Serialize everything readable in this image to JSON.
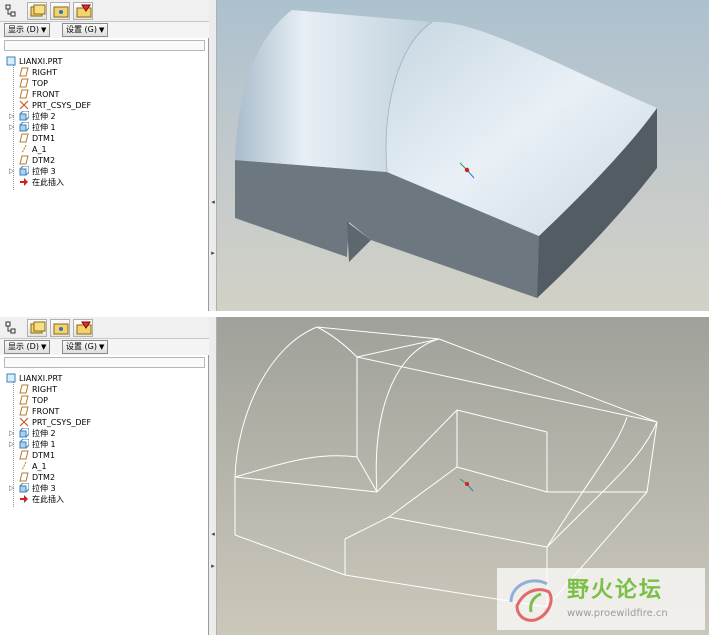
{
  "panels": [
    {
      "toolbar": {
        "menu_display": "显示",
        "menu_display_key": "(D)",
        "menu_settings": "设置",
        "menu_settings_key": "(G)"
      },
      "tree": [
        {
          "label": "LIANXI.PRT",
          "icon": "part-icon"
        },
        {
          "label": "RIGHT",
          "icon": "datum-plane-icon"
        },
        {
          "label": "TOP",
          "icon": "datum-plane-icon"
        },
        {
          "label": "FRONT",
          "icon": "datum-plane-icon"
        },
        {
          "label": "PRT_CSYS_DEF",
          "icon": "csys-icon"
        },
        {
          "label": "拉伸 2",
          "icon": "extrude-icon"
        },
        {
          "label": "拉伸 1",
          "icon": "extrude-icon"
        },
        {
          "label": "DTM1",
          "icon": "datum-plane-icon"
        },
        {
          "label": "A_1",
          "icon": "datum-axis-icon"
        },
        {
          "label": "DTM2",
          "icon": "datum-plane-icon"
        },
        {
          "label": "拉伸 3",
          "icon": "extrude-icon"
        },
        {
          "label": "在此插入",
          "icon": "insert-here-icon"
        }
      ],
      "view_mode": "shaded"
    },
    {
      "toolbar": {
        "menu_display": "显示",
        "menu_display_key": "(D)",
        "menu_settings": "设置",
        "menu_settings_key": "(G)"
      },
      "tree": [
        {
          "label": "LIANXI.PRT",
          "icon": "part-icon"
        },
        {
          "label": "RIGHT",
          "icon": "datum-plane-icon"
        },
        {
          "label": "TOP",
          "icon": "datum-plane-icon"
        },
        {
          "label": "FRONT",
          "icon": "datum-plane-icon"
        },
        {
          "label": "PRT_CSYS_DEF",
          "icon": "csys-icon"
        },
        {
          "label": "拉伸 2",
          "icon": "extrude-icon"
        },
        {
          "label": "拉伸 1",
          "icon": "extrude-icon"
        },
        {
          "label": "DTM1",
          "icon": "datum-plane-icon"
        },
        {
          "label": "A_1",
          "icon": "datum-axis-icon"
        },
        {
          "label": "DTM2",
          "icon": "datum-plane-icon"
        },
        {
          "label": "拉伸 3",
          "icon": "extrude-icon"
        },
        {
          "label": "在此插入",
          "icon": "insert-here-icon"
        }
      ],
      "view_mode": "wireframe"
    }
  ],
  "watermark": {
    "title": "野火论坛",
    "url": "www.proewildfire.cn"
  },
  "colors": {
    "model_light": "#d9e6f0",
    "model_side": "#6f7a82",
    "wire": "#ffffff",
    "tree_plane": "#c08a3a"
  }
}
